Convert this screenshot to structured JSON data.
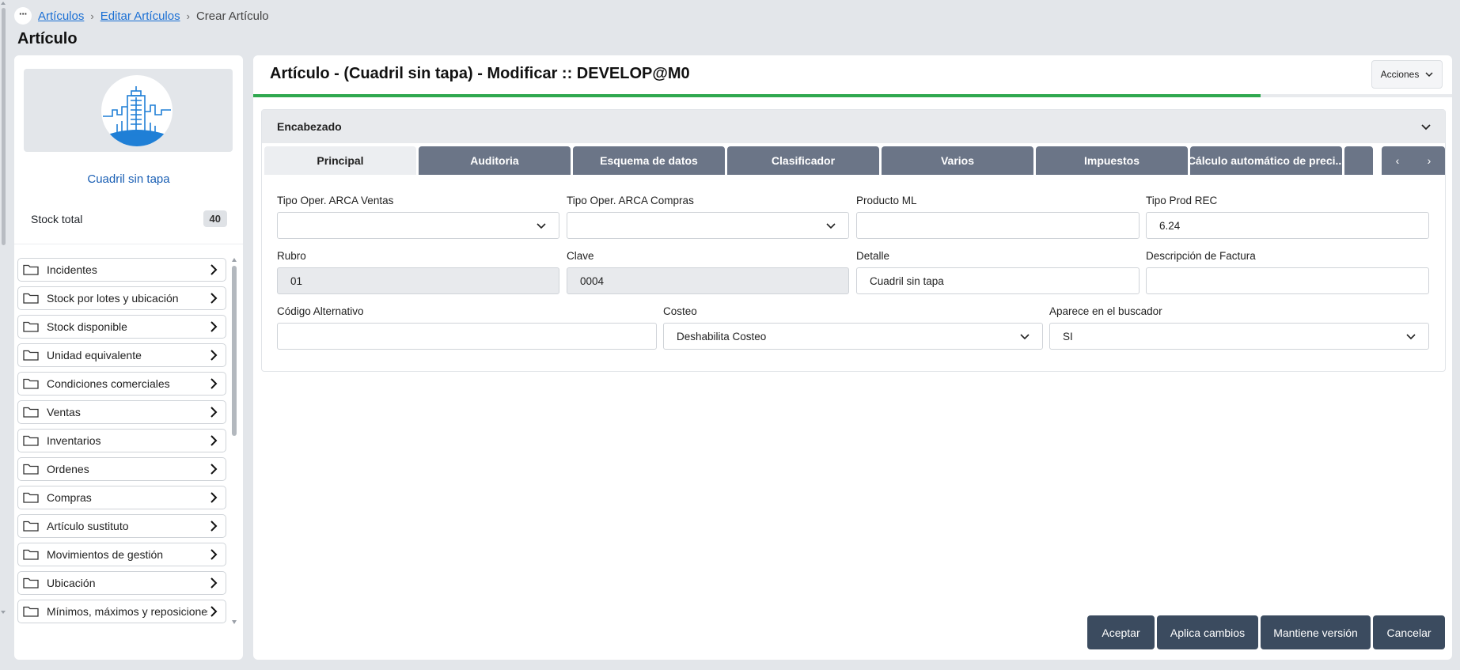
{
  "breadcrumb": {
    "more": "···",
    "items": [
      "Artículos",
      "Editar Artículos"
    ],
    "current": "Crear Artículo"
  },
  "page_title": "Artículo",
  "left": {
    "item_name": "Cuadril sin tapa",
    "stock_label": "Stock total",
    "stock_value": "40",
    "items": [
      {
        "label": "Incidentes"
      },
      {
        "label": "Stock por lotes y ubicación"
      },
      {
        "label": "Stock disponible"
      },
      {
        "label": "Unidad equivalente"
      },
      {
        "label": "Condiciones comerciales"
      },
      {
        "label": "Ventas"
      },
      {
        "label": "Inventarios"
      },
      {
        "label": "Ordenes"
      },
      {
        "label": "Compras"
      },
      {
        "label": "Artículo sustituto"
      },
      {
        "label": "Movimientos de gestión"
      },
      {
        "label": "Ubicación"
      },
      {
        "label": "Mínimos, máximos y reposiciones"
      }
    ]
  },
  "main": {
    "title": "Artículo - (Cuadril sin tapa) - Modificar :: DEVELOP@M0",
    "actions_label": "Acciones",
    "progress": 0.84,
    "section_title": "Encabezado",
    "tabs": [
      {
        "label": "Principal",
        "active": true
      },
      {
        "label": "Auditoria"
      },
      {
        "label": "Esquema de datos"
      },
      {
        "label": "Clasificador"
      },
      {
        "label": "Varios"
      },
      {
        "label": "Impuestos"
      },
      {
        "label": "Cálculo automático de preci..."
      },
      {
        "label": ""
      }
    ],
    "tab_prev": "‹",
    "tab_next": "›",
    "fields": {
      "tipo_oper_ventas": {
        "label": "Tipo Oper. ARCA Ventas",
        "value": ""
      },
      "tipo_oper_compras": {
        "label": "Tipo Oper. ARCA Compras",
        "value": ""
      },
      "producto_ml": {
        "label": "Producto ML",
        "value": ""
      },
      "tipo_prod_rec": {
        "label": "Tipo Prod REC",
        "value": "6.24"
      },
      "rubro": {
        "label": "Rubro",
        "value": "01"
      },
      "clave": {
        "label": "Clave",
        "value": "0004"
      },
      "detalle": {
        "label": "Detalle",
        "value": "Cuadril sin tapa"
      },
      "descripcion_factura": {
        "label": "Descripción de Factura",
        "value": ""
      },
      "codigo_alternativo": {
        "label": "Código Alternativo",
        "value": ""
      },
      "costeo": {
        "label": "Costeo",
        "value": "Deshabilita Costeo"
      },
      "aparece_buscador": {
        "label": "Aparece en el buscador",
        "value": "SI"
      }
    },
    "buttons": {
      "aceptar": "Aceptar",
      "aplica": "Aplica cambios",
      "mantiene": "Mantiene versión",
      "cancelar": "Cancelar"
    }
  },
  "colors": {
    "link": "#1a6fd4",
    "progress": "#2fa84f",
    "tab": "#6b7587",
    "button": "#3b4b5f",
    "avatar_accent": "#1f7fd6"
  }
}
